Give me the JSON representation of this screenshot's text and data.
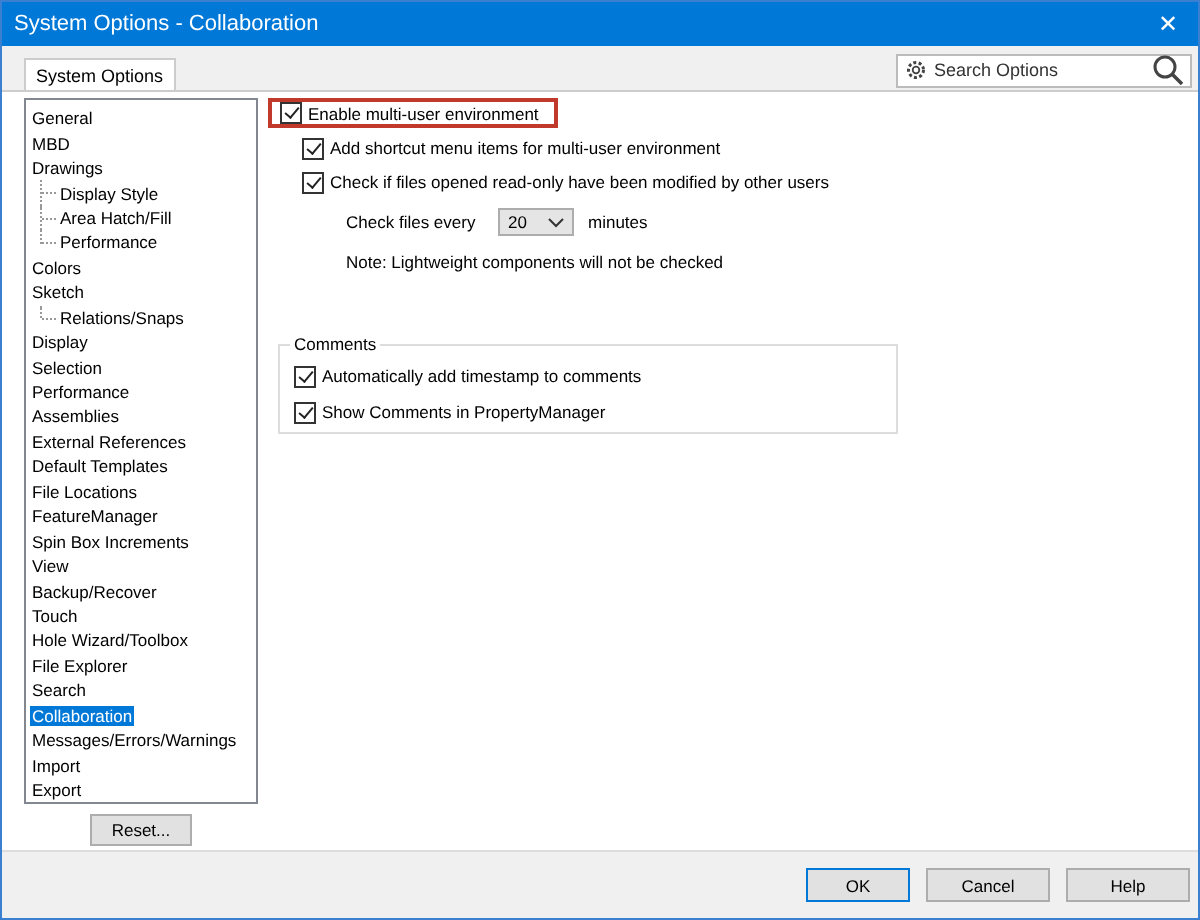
{
  "window": {
    "title": "System Options - Collaboration",
    "close": "✕"
  },
  "tabs": [
    {
      "label": "System Options",
      "selected": true
    }
  ],
  "search": {
    "placeholder": "Search Options"
  },
  "tree": [
    {
      "label": "General",
      "selected": false
    },
    {
      "label": "MBD",
      "selected": false
    },
    {
      "label": "Drawings",
      "selected": false,
      "children": [
        {
          "label": "Display Style",
          "selected": false
        },
        {
          "label": "Area Hatch/Fill",
          "selected": false
        },
        {
          "label": "Performance",
          "selected": false
        }
      ]
    },
    {
      "label": "Colors",
      "selected": false
    },
    {
      "label": "Sketch",
      "selected": false,
      "children": [
        {
          "label": "Relations/Snaps",
          "selected": false
        }
      ]
    },
    {
      "label": "Display",
      "selected": false
    },
    {
      "label": "Selection",
      "selected": false
    },
    {
      "label": "Performance",
      "selected": false
    },
    {
      "label": "Assemblies",
      "selected": false
    },
    {
      "label": "External References",
      "selected": false
    },
    {
      "label": "Default Templates",
      "selected": false
    },
    {
      "label": "File Locations",
      "selected": false
    },
    {
      "label": "FeatureManager",
      "selected": false
    },
    {
      "label": "Spin Box Increments",
      "selected": false
    },
    {
      "label": "View",
      "selected": false
    },
    {
      "label": "Backup/Recover",
      "selected": false
    },
    {
      "label": "Touch",
      "selected": false
    },
    {
      "label": "Hole Wizard/Toolbox",
      "selected": false
    },
    {
      "label": "File Explorer",
      "selected": false
    },
    {
      "label": "Search",
      "selected": false
    },
    {
      "label": "Collaboration",
      "selected": true
    },
    {
      "label": "Messages/Errors/Warnings",
      "selected": false
    },
    {
      "label": "Import",
      "selected": false
    },
    {
      "label": "Export",
      "selected": false
    }
  ],
  "reset_button": "Reset...",
  "options": [
    {
      "label": "Enable multi-user environment",
      "checked": true,
      "highlighted": true
    },
    {
      "label": "Add shortcut menu items for multi-user environment",
      "checked": true,
      "highlighted": false
    },
    {
      "label": "Check if files opened read-only have been modified by other users",
      "checked": true,
      "highlighted": false
    }
  ],
  "check_interval": {
    "label": "Check files every",
    "value": "20",
    "unit": "minutes"
  },
  "note": "Note: Lightweight components will not be checked",
  "comments": {
    "title": "Comments",
    "options": [
      {
        "label": "Automatically add timestamp to comments",
        "checked": true
      },
      {
        "label": "Show Comments in PropertyManager",
        "checked": true
      }
    ]
  },
  "buttons": [
    {
      "label": "OK",
      "default": true
    },
    {
      "label": "Cancel",
      "default": false
    },
    {
      "label": "Help",
      "default": false
    }
  ]
}
